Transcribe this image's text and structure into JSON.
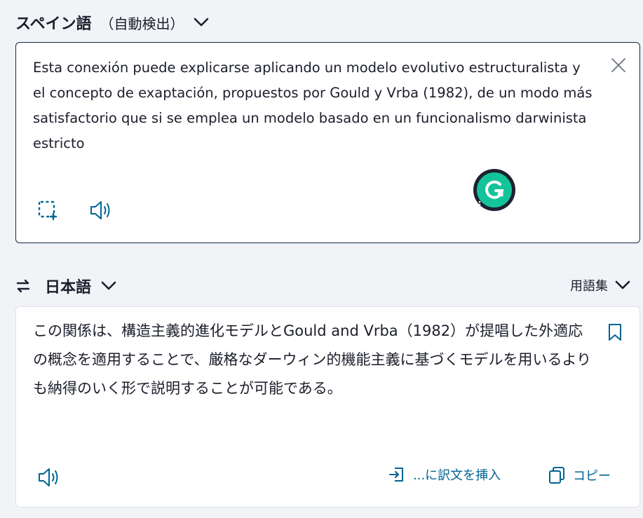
{
  "source": {
    "language": "スペイン語",
    "detect_label": "（自動検出）",
    "text": "Esta conexión puede explicarse aplicando un modelo evolutivo estructuralista y el concepto de exaptación, propuestos por Gould y Vrba (1982), de un modo más satisfactorio que si se emplea un modelo basado en un funcionalismo darwinista estricto"
  },
  "target": {
    "language": "日本語",
    "glossary_label": "用語集",
    "text": "この関係は、構造主義的進化モデルとGould and Vrba（1982）が提唱した外適応の概念を適用することで、厳格なダーウィン的機能主義に基づくモデルを用いるよりも納得のいく形で説明することが可能である。",
    "insert_label": "...に訳文を挿入",
    "copy_label": "コピー"
  },
  "icons": {
    "chevron": "chevron-down-icon",
    "close": "close-icon",
    "select": "select-area-icon",
    "speaker": "speaker-icon",
    "swap": "swap-icon",
    "bookmark": "bookmark-icon",
    "insert": "insert-icon",
    "copy": "copy-icon",
    "grammarly": "grammarly-icon"
  },
  "colors": {
    "accent": "#006494",
    "grammarly": "#15c39a",
    "border_active": "#0f2b46",
    "background": "#f1f3f7"
  }
}
